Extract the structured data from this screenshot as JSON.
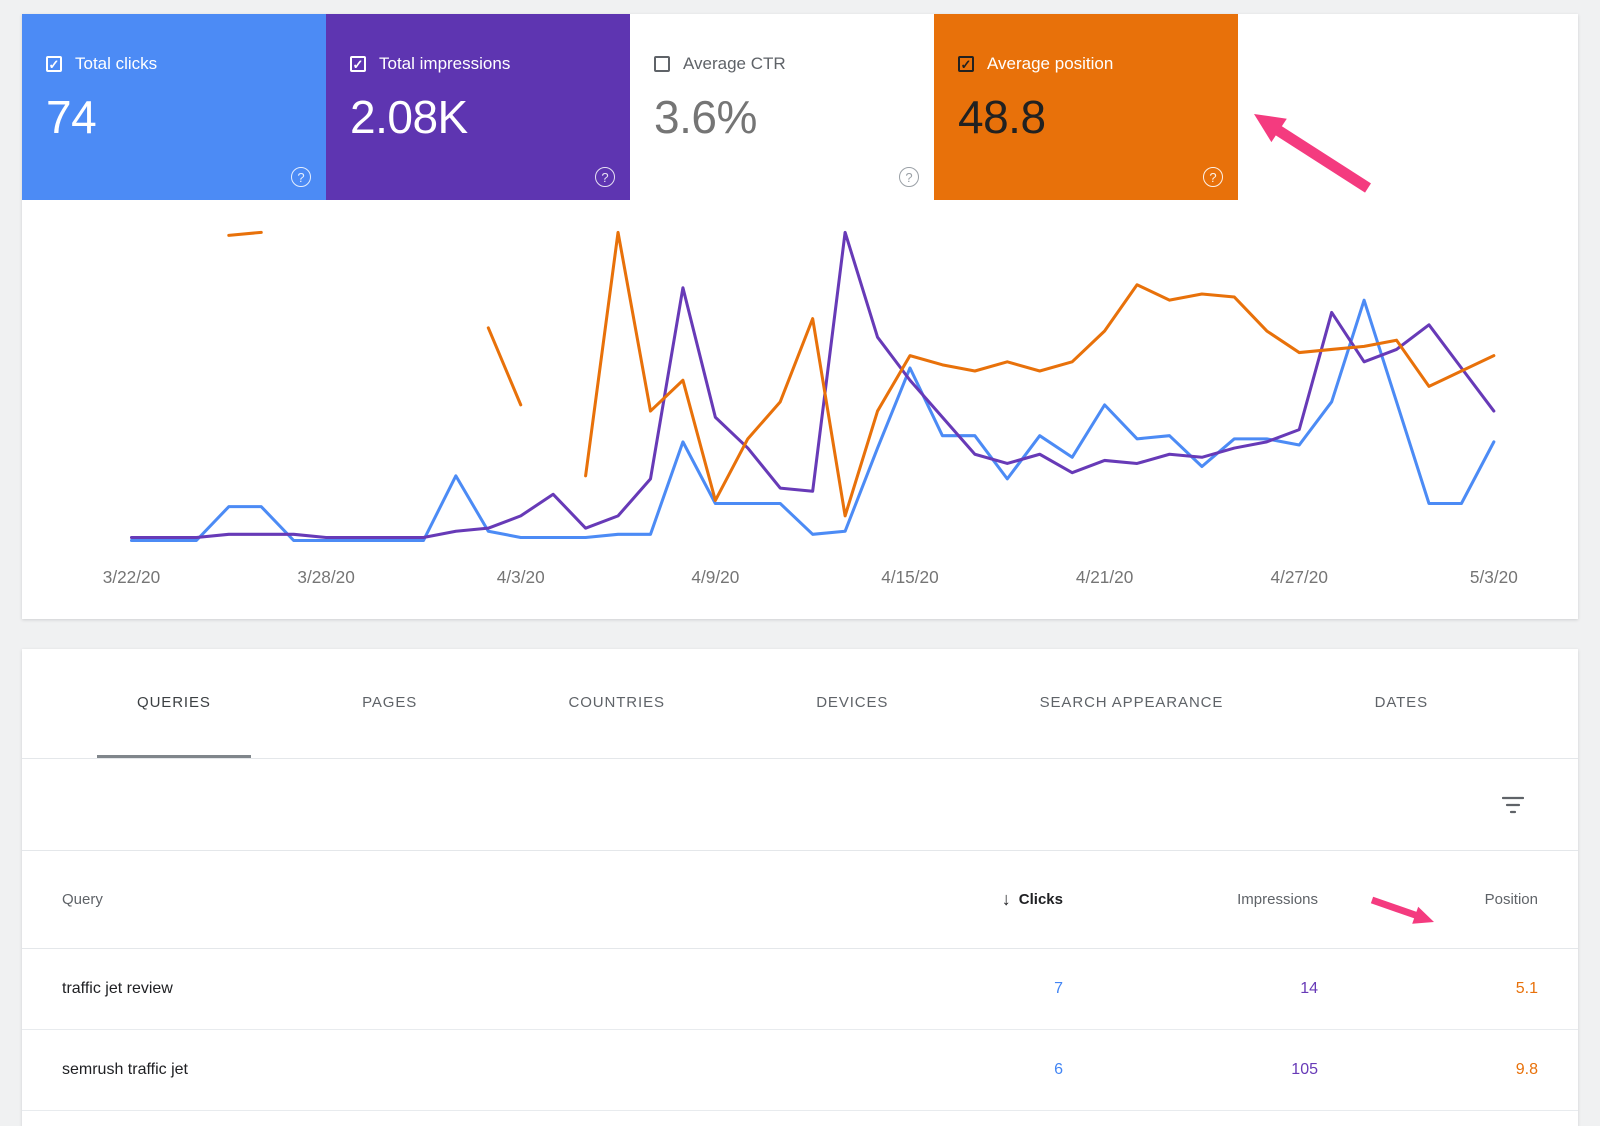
{
  "cards": [
    {
      "label": "Total clicks",
      "value": "74",
      "checked": true,
      "check_glyph": "✓",
      "bg": "#4c8bf5",
      "fg": "#ffffff",
      "value_color": "#ffffff",
      "checkbox_color": "#ffffff",
      "help_color": "rgba(255,255,255,0.85)"
    },
    {
      "label": "Total impressions",
      "value": "2.08K",
      "checked": true,
      "check_glyph": "✓",
      "bg": "#5e35b1",
      "fg": "#ffffff",
      "value_color": "#ffffff",
      "checkbox_color": "#ffffff",
      "help_color": "rgba(255,255,255,0.85)"
    },
    {
      "label": "Average CTR",
      "value": "3.6%",
      "checked": false,
      "check_glyph": "",
      "bg": "#ffffff",
      "fg": "#5f6368",
      "value_color": "#757575",
      "checkbox_color": "#5f6368",
      "help_color": "#9aa0a6"
    },
    {
      "label": "Average position",
      "value": "48.8",
      "checked": true,
      "check_glyph": "✓",
      "bg": "#e8710a",
      "fg": "#ffffff",
      "value_color": "#212121",
      "checkbox_color": "#212121",
      "help_color": "rgba(255,255,255,0.9)"
    }
  ],
  "icons": {
    "help": "?",
    "sort_desc": "↓",
    "checkbox_check": "✓"
  },
  "chart_data": {
    "type": "line",
    "title": "Search performance over time",
    "x": [
      "3/22/20",
      "3/23/20",
      "3/24/20",
      "3/25/20",
      "3/26/20",
      "3/27/20",
      "3/28/20",
      "3/29/20",
      "3/30/20",
      "3/31/20",
      "4/1/20",
      "4/2/20",
      "4/3/20",
      "4/4/20",
      "4/5/20",
      "4/6/20",
      "4/7/20",
      "4/8/20",
      "4/9/20",
      "4/10/20",
      "4/11/20",
      "4/12/20",
      "4/13/20",
      "4/14/20",
      "4/15/20",
      "4/16/20",
      "4/17/20",
      "4/18/20",
      "4/19/20",
      "4/20/20",
      "4/21/20",
      "4/22/20",
      "4/23/20",
      "4/24/20",
      "4/25/20",
      "4/26/20",
      "4/27/20",
      "4/28/20",
      "4/29/20",
      "4/30/20",
      "5/1/20",
      "5/2/20",
      "5/3/20"
    ],
    "x_tick_labels": [
      "3/22/20",
      "3/28/20",
      "4/3/20",
      "4/9/20",
      "4/15/20",
      "4/21/20",
      "4/27/20",
      "5/3/20"
    ],
    "x_tick_indices": [
      0,
      6,
      12,
      18,
      24,
      30,
      36,
      42
    ],
    "y_axis_labels_visible": false,
    "ylim": [
      0,
      100
    ],
    "grid": false,
    "legend": "none (color-coded to metric cards)",
    "series": [
      {
        "name": "Clicks",
        "color": "#4c8bf5",
        "values": [
          0,
          0,
          0,
          11,
          11,
          0,
          0,
          0,
          0,
          0,
          21,
          3,
          1,
          1,
          1,
          2,
          2,
          32,
          12,
          12,
          12,
          2,
          3,
          30,
          56,
          34,
          34,
          20,
          34,
          27,
          44,
          33,
          34,
          24,
          33,
          33,
          31,
          45,
          78,
          45,
          12,
          12,
          32
        ]
      },
      {
        "name": "Impressions",
        "color": "#673ab7",
        "values": [
          1,
          1,
          1,
          2,
          2,
          2,
          1,
          1,
          1,
          1,
          3,
          4,
          8,
          15,
          4,
          8,
          20,
          82,
          40,
          30,
          17,
          16,
          100,
          66,
          52,
          40,
          28,
          25,
          28,
          22,
          26,
          25,
          28,
          27,
          30,
          32,
          36,
          74,
          58,
          62,
          70,
          56,
          42
        ]
      },
      {
        "name": "Position",
        "color": "#e8710a",
        "values": [
          null,
          null,
          null,
          99,
          100,
          null,
          null,
          null,
          null,
          null,
          null,
          69,
          44,
          null,
          21,
          100,
          42,
          52,
          13,
          33,
          45,
          72,
          8,
          42,
          60,
          57,
          55,
          58,
          55,
          58,
          68,
          83,
          78,
          80,
          79,
          68,
          61,
          62,
          63,
          65,
          50,
          55,
          60
        ]
      }
    ]
  },
  "tabs": {
    "items": [
      {
        "label": "QUERIES",
        "active": true
      },
      {
        "label": "PAGES",
        "active": false
      },
      {
        "label": "COUNTRIES",
        "active": false
      },
      {
        "label": "DEVICES",
        "active": false
      },
      {
        "label": "SEARCH APPEARANCE",
        "active": false
      },
      {
        "label": "DATES",
        "active": false
      }
    ]
  },
  "table": {
    "columns": {
      "query": "Query",
      "clicks": "Clicks",
      "impressions": "Impressions",
      "position": "Position"
    },
    "sort": {
      "column": "Clicks",
      "direction": "desc",
      "glyph": "↓"
    },
    "value_colors": {
      "clicks": "#4285f4",
      "impressions": "#673ab7",
      "position": "#e8710a"
    },
    "rows": [
      {
        "query": "traffic jet review",
        "clicks": "7",
        "impressions": "14",
        "position": "5.1"
      },
      {
        "query": "semrush traffic jet",
        "clicks": "6",
        "impressions": "105",
        "position": "9.8"
      }
    ]
  },
  "annotations": {
    "arrow_color": "#f43b7f"
  }
}
